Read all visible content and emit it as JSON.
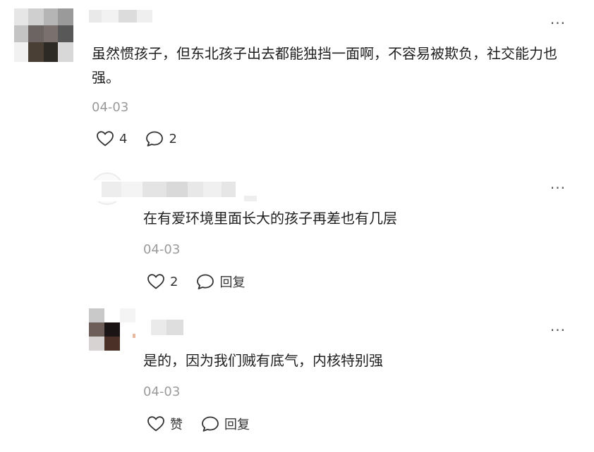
{
  "comments": [
    {
      "text": "虽然惯孩子，但东北孩子出去都能独挡一面啊，不容易被欺负，社交能力也强。",
      "date": "04-03",
      "like_count": "4",
      "reply_count": "2",
      "more": "···"
    },
    {
      "text": "在有爱环境里面长大的孩子再差也有几层",
      "date": "04-03",
      "like_count": "2",
      "reply_label": "回复",
      "more": "···"
    },
    {
      "text": "是的，因为我们贼有底气，内核特别强",
      "date": "04-03",
      "like_label": "赞",
      "reply_label": "回复",
      "more": "···"
    }
  ],
  "colors": {
    "text": "#1f1f1f",
    "date": "#9a9a9a",
    "icon": "#333333"
  },
  "icons": {
    "like": "heart-outline-icon",
    "reply": "speech-bubble-icon",
    "more": "ellipsis-icon"
  }
}
